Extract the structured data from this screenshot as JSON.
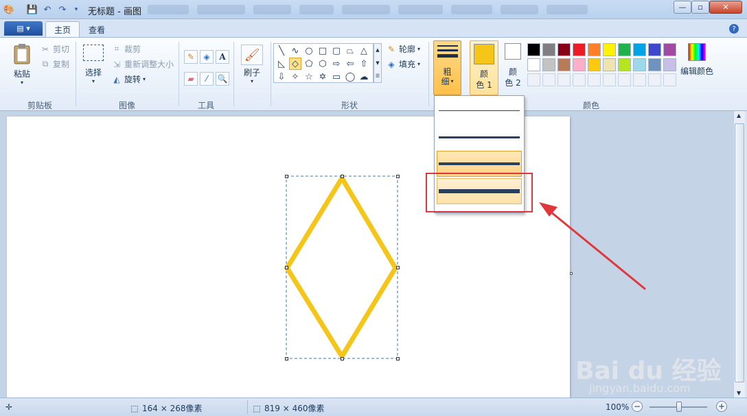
{
  "window": {
    "title": "无标题 - 画图",
    "minimize": "—",
    "maximize": "▫",
    "close": "✕"
  },
  "quick_access": {
    "icons": [
      "paint-app-icon",
      "save-icon",
      "undo-icon",
      "redo-icon",
      "customize-icon"
    ]
  },
  "tabs": {
    "file_menu_icon": "▤",
    "file_caret": "▾",
    "home": "主页",
    "view": "查看",
    "help": "?"
  },
  "ribbon": {
    "clipboard": {
      "label": "剪贴板",
      "paste": "粘贴",
      "cut": "剪切",
      "copy": "复制"
    },
    "image": {
      "label": "图像",
      "select": "选择",
      "crop": "裁剪",
      "resize": "重新调整大小",
      "rotate": "旋转"
    },
    "tools": {
      "label": "工具"
    },
    "brushes": {
      "label": "刷子"
    },
    "shapes": {
      "label": "形状",
      "outline": "轮廓",
      "fill": "填充"
    },
    "size": {
      "label1": "粗",
      "label2": "细"
    },
    "colors": {
      "label": "颜色",
      "color1_a": "颜",
      "color1_b": "色 1",
      "color2_a": "颜",
      "color2_b": "色 2",
      "edit": "编辑颜色",
      "color1_value": "#f5c518",
      "color2_value": "#ffffff",
      "palette_row1": [
        "#000000",
        "#7f7f7f",
        "#880015",
        "#ed1c24",
        "#ff7f27",
        "#fff200",
        "#22b14c",
        "#00a2e8",
        "#3f48cc",
        "#a349a4"
      ],
      "palette_row2": [
        "#ffffff",
        "#c3c3c3",
        "#b97a57",
        "#ffaec9",
        "#ffc90e",
        "#efe4b0",
        "#b5e61d",
        "#99d9ea",
        "#7092be",
        "#c8bfe7"
      ]
    }
  },
  "size_dropdown": {
    "options": [
      "1px",
      "3px",
      "5px",
      "8px"
    ],
    "hovered": "5px",
    "selected": "8px"
  },
  "status": {
    "selection": "164 × 268像素",
    "canvas": "819 × 460像素",
    "zoom": "100%"
  },
  "watermark": {
    "brand": "Bai du 经验",
    "url": "jingyan.baidu.com"
  }
}
